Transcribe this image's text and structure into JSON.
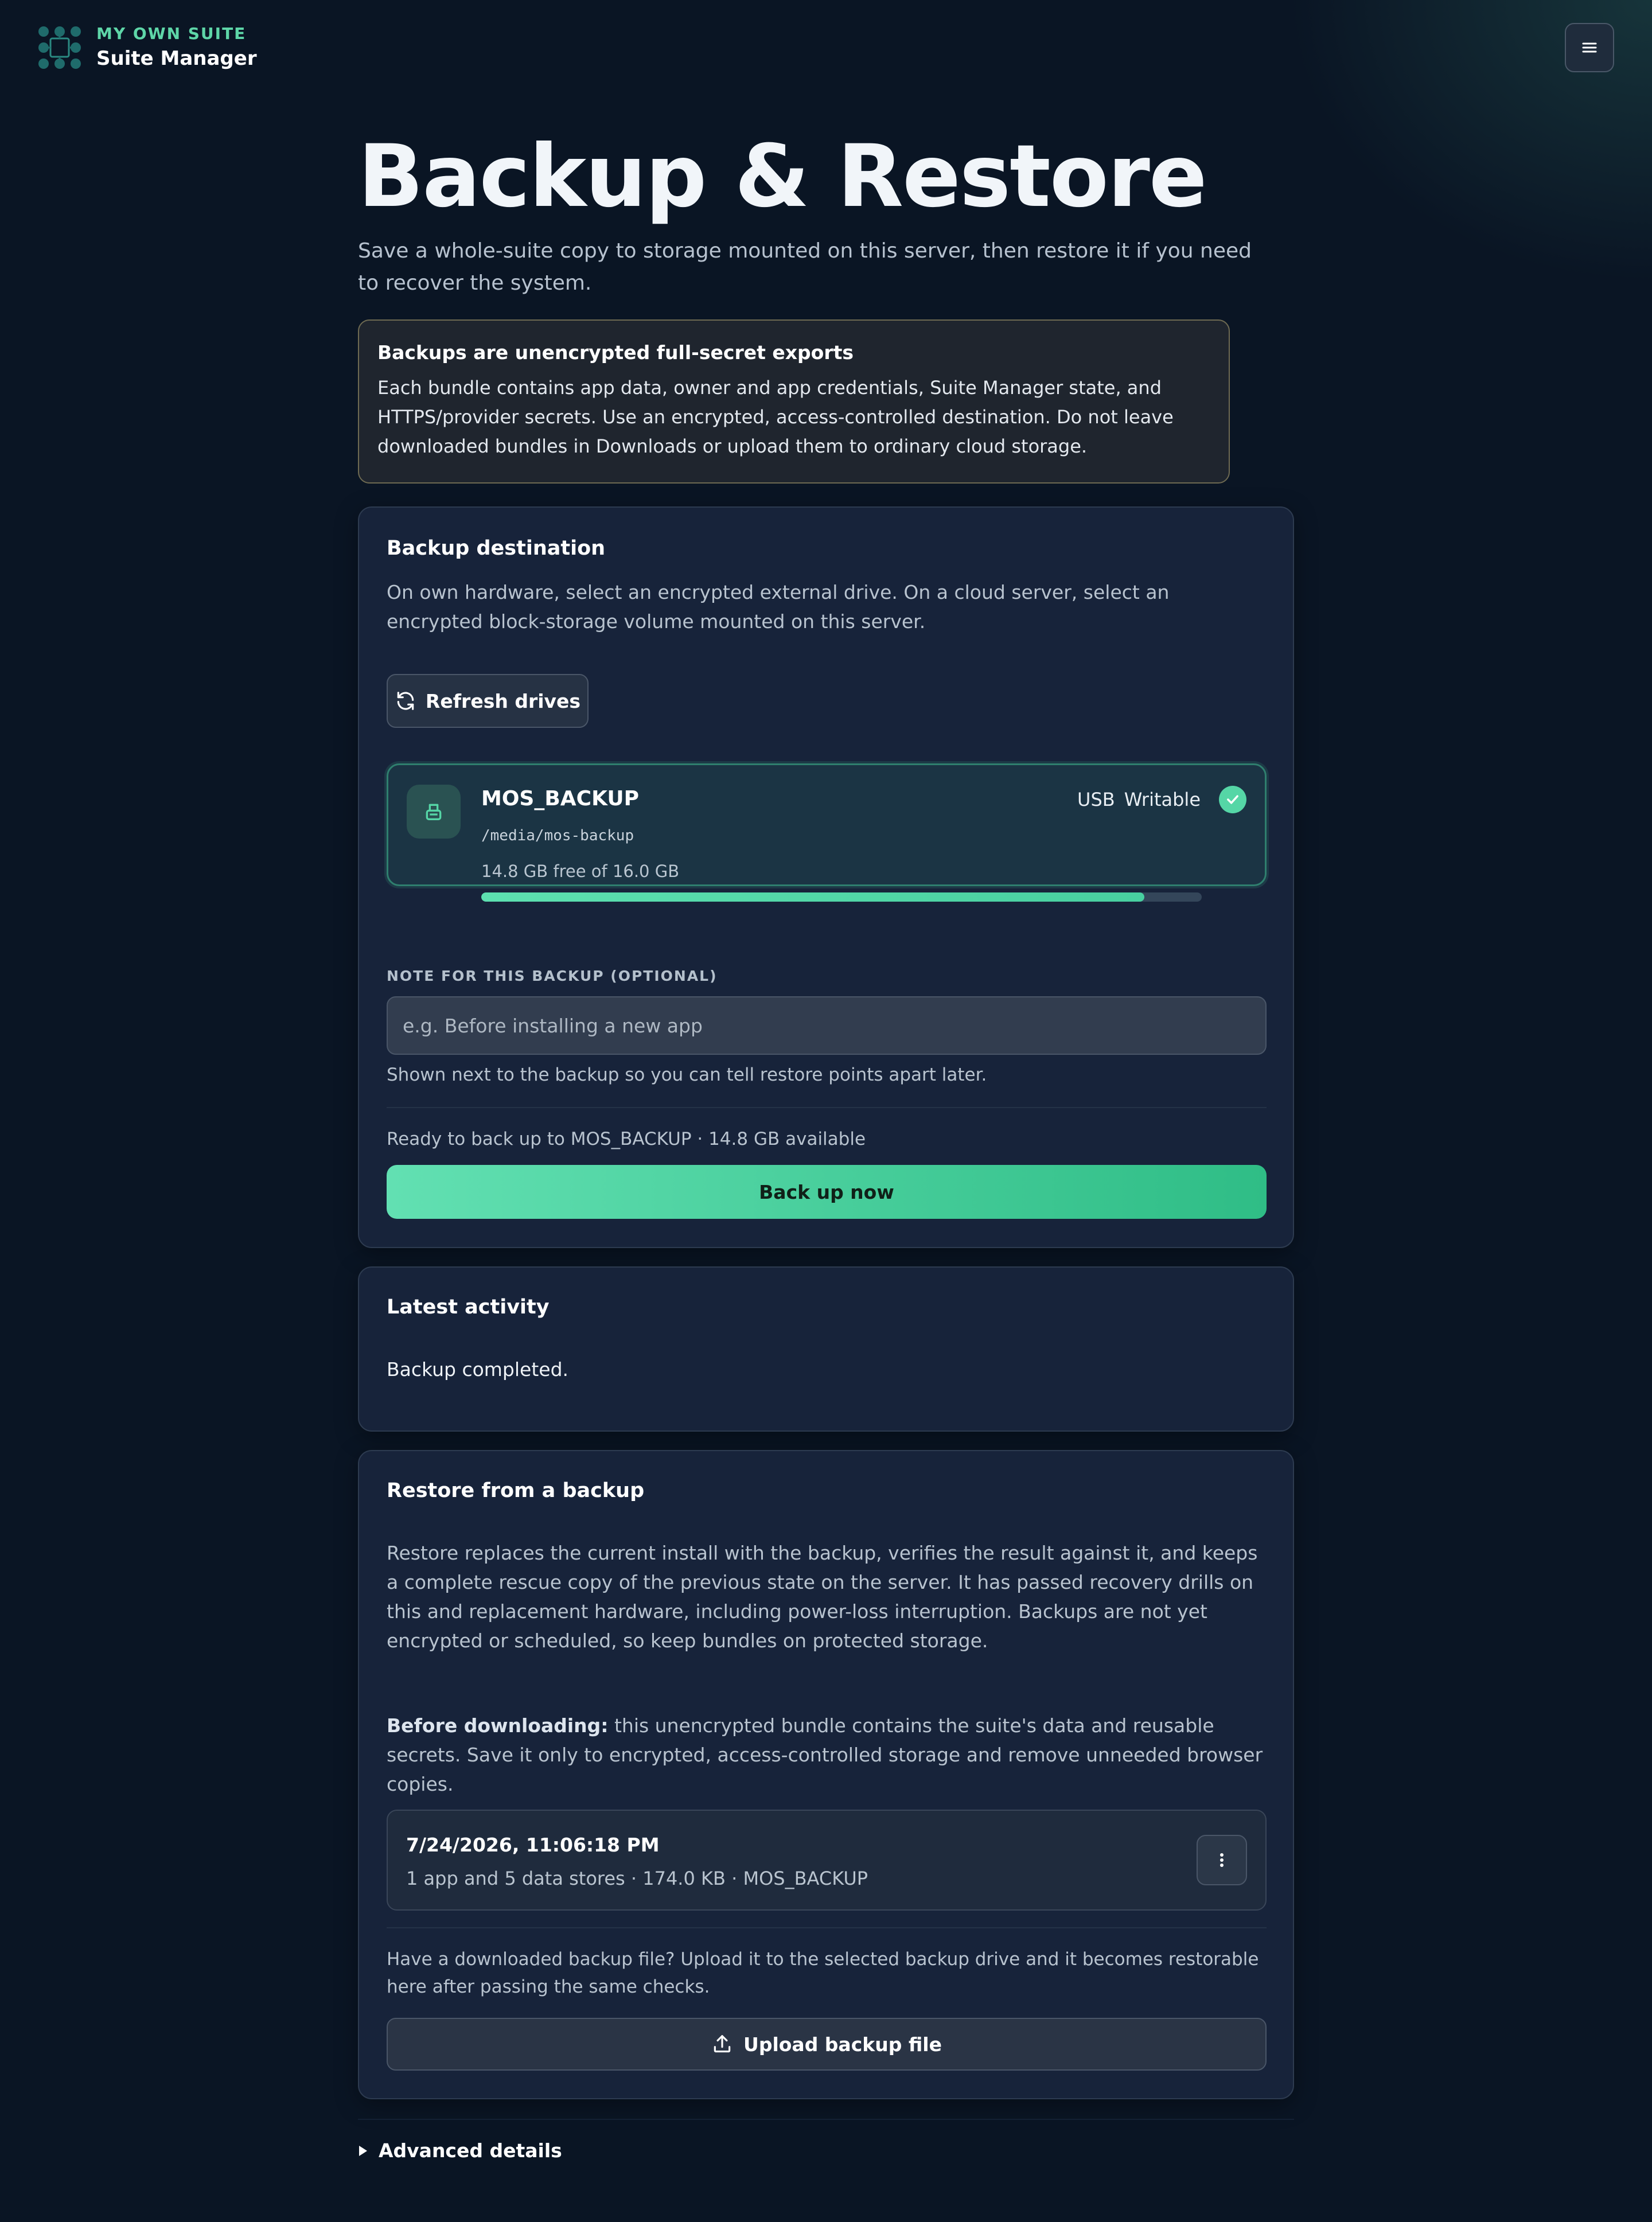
{
  "header": {
    "kicker": "MY OWN SUITE",
    "app_name": "Suite Manager",
    "logo_icon": "suite-grid-logo",
    "menu_icon": "hamburger-menu-icon"
  },
  "page": {
    "title": "Backup & Restore",
    "subtitle": "Save a whole-suite copy to storage mounted on this server, then restore it if you need to recover the system."
  },
  "warning": {
    "title": "Backups are unencrypted full-secret exports",
    "body": "Each bundle contains app data, owner and app credentials, Suite Manager state, and HTTPS/provider secrets. Use an encrypted, access-controlled destination. Do not leave downloaded bundles in Downloads or upload them to ordinary cloud storage."
  },
  "destination": {
    "title": "Backup destination",
    "description": "On own hardware, select an encrypted external drive. On a cloud server, select an encrypted block-storage volume mounted on this server.",
    "refresh_label": "Refresh drives",
    "drive": {
      "name": "MOS_BACKUP",
      "path": "/media/mos-backup",
      "free_text": "14.8 GB free of 16.0 GB",
      "free_fraction": 0.92,
      "type": "USB",
      "status": "Writable",
      "selected": true
    },
    "note_label": "NOTE FOR THIS BACKUP (OPTIONAL)",
    "note_placeholder": "e.g. Before installing a new app",
    "note_value": "",
    "note_help": "Shown next to the backup so you can tell restore points apart later.",
    "ready_text": "Ready to back up to MOS_BACKUP · 14.8 GB available",
    "backup_label": "Back up now"
  },
  "activity": {
    "title": "Latest activity",
    "text": "Backup completed."
  },
  "restore": {
    "title": "Restore from a backup",
    "description": "Restore replaces the current install with the backup, verifies the result against it, and keeps a complete rescue copy of the previous state on the server. It has passed recovery drills on this and replacement hardware, including power-loss interruption. Backups are not yet encrypted or scheduled, so keep bundles on protected storage.",
    "download_bold": "Before downloading:",
    "download_text": " this unencrypted bundle contains the suite's data and reusable secrets. Save it only to encrypted, access-controlled storage and remove unneeded browser copies.",
    "backups": [
      {
        "date": "7/24/2026, 11:06:18 PM",
        "meta": "1 app and 5 data stores · 174.0 KB · MOS_BACKUP"
      }
    ],
    "upload_text": "Have a downloaded backup file? Upload it to the selected backup drive and it becomes restorable here after passing the same checks.",
    "upload_label": "Upload backup file"
  },
  "advanced": {
    "label": "Advanced details"
  },
  "colors": {
    "accent": "#5ed6a8",
    "background": "#0a1524",
    "card": "#17233a",
    "warning_border": "#6e6a52"
  }
}
